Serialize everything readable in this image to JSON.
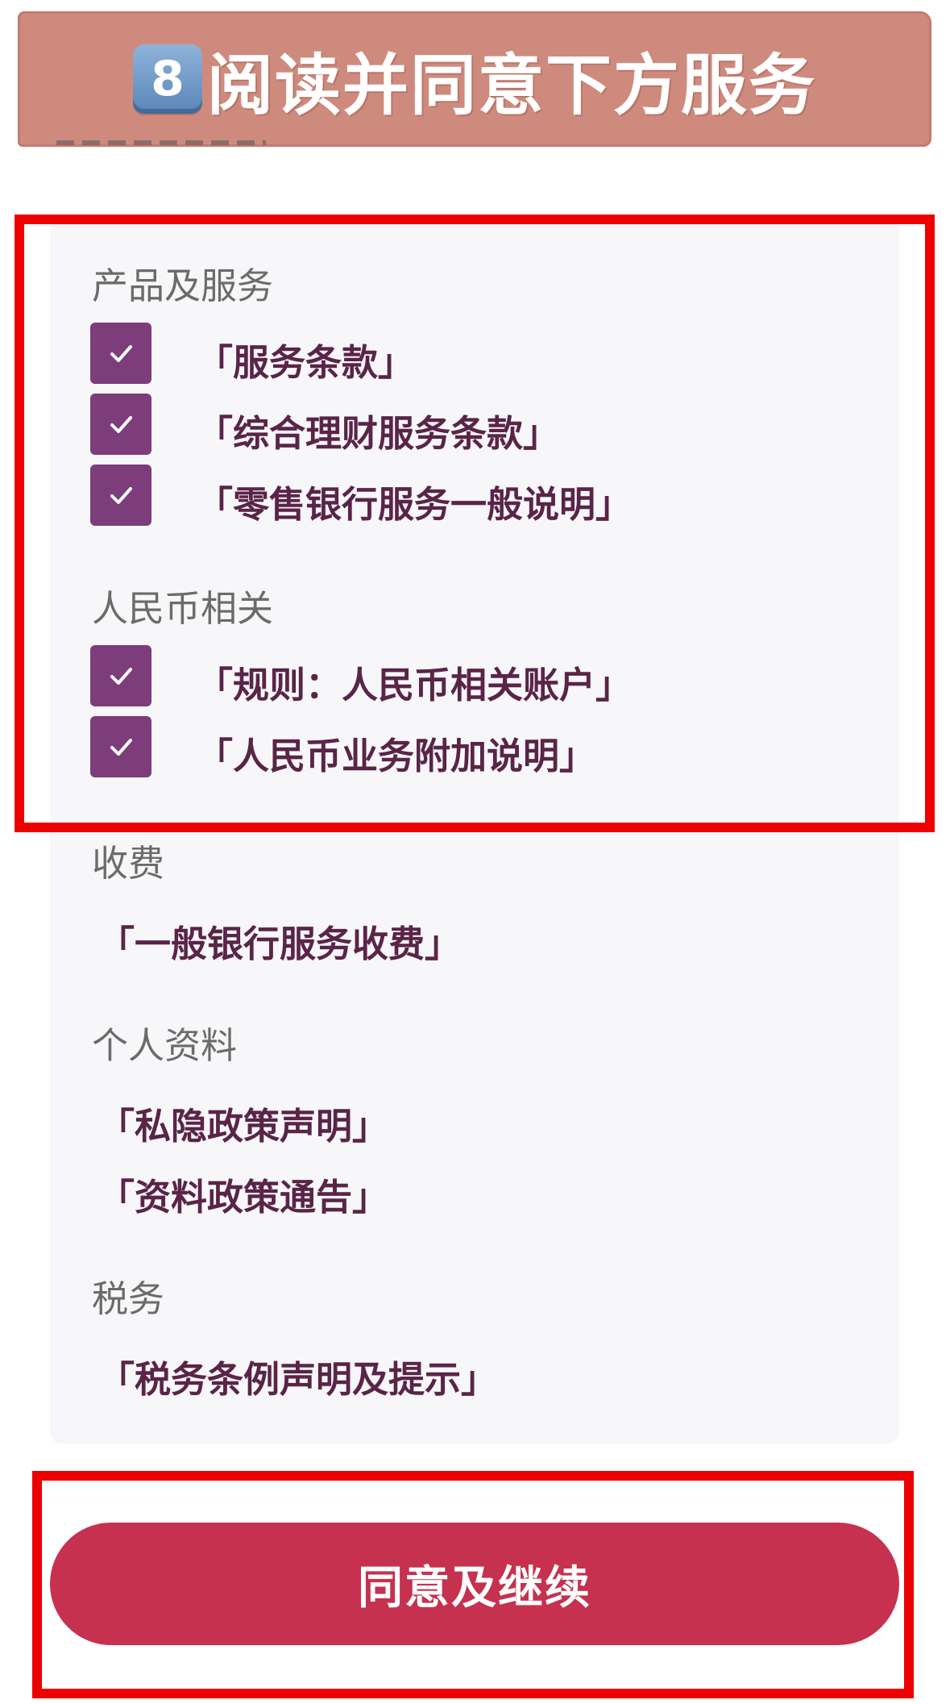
{
  "banner": {
    "step_number": "8",
    "title": "阅读并同意下方服务"
  },
  "sections": {
    "products": {
      "heading": "产品及服务",
      "items": [
        {
          "label": "「服务条款」",
          "checked": true
        },
        {
          "label": "「综合理财服务条款」",
          "checked": true
        },
        {
          "label": "「零售银行服务一般说明」",
          "checked": true
        }
      ]
    },
    "rmb": {
      "heading": "人民币相关",
      "items": [
        {
          "label": "「规则：人民币相关账户」",
          "checked": true
        },
        {
          "label": "「人民币业务附加说明」",
          "checked": true
        }
      ]
    },
    "fees": {
      "heading": "收费",
      "links": [
        "「一般银行服务收费」"
      ]
    },
    "personal": {
      "heading": "个人资料",
      "links": [
        "「私隐政策声明」",
        "「资料政策通告」"
      ]
    },
    "tax": {
      "heading": "税务",
      "links": [
        "「税务条例声明及提示」"
      ]
    }
  },
  "agree_button": {
    "label": "同意及继续"
  },
  "colors": {
    "banner": "#cf8a7e",
    "checkbox": "#7c3d7a",
    "link_text": "#5a2448",
    "heading_text": "#6b6b6b",
    "button": "#c6314f",
    "highlight": "#ee0000",
    "card": "#f7f7f9"
  },
  "icons": {
    "checkbox": "checkmark-icon",
    "step_badge": "keycap-digit-icon"
  }
}
